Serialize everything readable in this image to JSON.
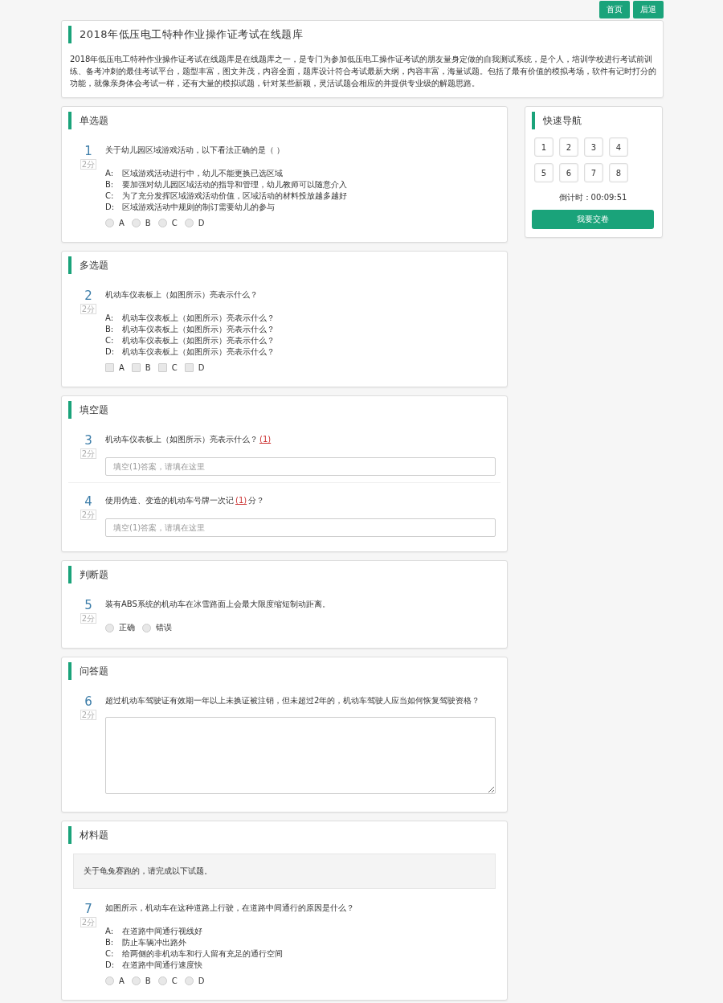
{
  "header_buttons": [
    {
      "label": "首页"
    },
    {
      "label": "后退"
    }
  ],
  "intro": {
    "title": "2018年低压电工特种作业操作证考试在线题库",
    "text": "2018年低压电工特种作业操作证考试在线题库是在线题库之一，是专门为参加低压电工操作证考试的朋友量身定做的自我测试系统，是个人，培训学校进行考试前训练、备考冲刺的最佳考试平台，题型丰富，图文并茂，内容全面，题库设计符合考试最新大纲，内容丰富，海量试题。包括了最有价值的模拟考场，软件有记时打分的功能，就像亲身体会考试一样，还有大量的模拟试题，针对某些新颖，灵活试题会相应的并提供专业级的解题思路。"
  },
  "sections": [
    {
      "title": "单选题",
      "kind": "choice",
      "questions": [
        {
          "number": "1",
          "score": "2分",
          "text": "关于幼儿园区域游戏活动，以下看法正确的是（        ）",
          "kind": "radio",
          "options": [
            {
              "letter": "A:",
              "text": "区域游戏活动进行中，幼儿不能更换已选区域"
            },
            {
              "letter": "B:",
              "text": "要加强对幼儿园区域活动的指导和管理，幼儿教师可以随意介入"
            },
            {
              "letter": "C:",
              "text": "为了充分发挥区域游戏活动价值，区域活动的材料投放越多越好"
            },
            {
              "letter": "D:",
              "text": "区域游戏活动中规则的制订需要幼儿的参与"
            }
          ],
          "choices": [
            {
              "label": "A",
              "selected": false
            },
            {
              "label": "B",
              "selected": false
            },
            {
              "label": "C",
              "selected": false
            },
            {
              "label": "D",
              "selected": false
            }
          ]
        }
      ]
    },
    {
      "title": "多选题",
      "kind": "choice",
      "questions": [
        {
          "number": "2",
          "score": "2分",
          "text": "机动车仪表板上（如图所示）亮表示什么？",
          "kind": "checkbox",
          "options": [
            {
              "letter": "A:",
              "text": "机动车仪表板上（如图所示）亮表示什么？"
            },
            {
              "letter": "B:",
              "text": "机动车仪表板上（如图所示）亮表示什么？"
            },
            {
              "letter": "C:",
              "text": "机动车仪表板上（如图所示）亮表示什么？"
            },
            {
              "letter": "D:",
              "text": "机动车仪表板上（如图所示）亮表示什么？"
            }
          ],
          "choices": [
            {
              "label": "A",
              "selected": false
            },
            {
              "label": "B",
              "selected": false
            },
            {
              "label": "C",
              "selected": false
            },
            {
              "label": "D",
              "selected": false
            }
          ]
        }
      ]
    },
    {
      "title": "填空题",
      "kind": "fill",
      "questions": [
        {
          "number": "3",
          "score": "2分",
          "text_before": "机动车仪表板上（如图所示）亮表示什么？",
          "blank": "(1)",
          "placeholder": "填空(1)答案，请填在这里"
        },
        {
          "number": "4",
          "score": "2分",
          "text_before": "使用伪造、变造的机动车号牌一次记",
          "blank": "(1)",
          "text_after": "分？",
          "placeholder": "填空(1)答案，请填在这里"
        }
      ]
    },
    {
      "title": "判断题",
      "kind": "choice",
      "questions": [
        {
          "number": "5",
          "score": "2分",
          "text": "装有ABS系统的机动车在冰雪路面上会最大限度缩短制动距离。",
          "kind": "radio",
          "choices": [
            {
              "label": "正确",
              "selected": false
            },
            {
              "label": "错误",
              "selected": false
            }
          ]
        }
      ]
    },
    {
      "title": "问答题",
      "kind": "essay",
      "questions": [
        {
          "number": "6",
          "score": "2分",
          "text": "超过机动车驾驶证有效期一年以上未换证被注销，但未超过2年的，机动车驾驶人应当如何恢复驾驶资格？"
        }
      ]
    },
    {
      "title": "材料题",
      "kind": "choice",
      "material": "关于龟兔赛跑的，请完成以下试题。",
      "questions": [
        {
          "number": "7",
          "score": "2分",
          "text": "如图所示，机动车在这种道路上行驶，在道路中间通行的原因是什么？",
          "kind": "radio",
          "options": [
            {
              "letter": "A:",
              "text": "在道路中间通行视线好"
            },
            {
              "letter": "B:",
              "text": "防止车辆冲出路外"
            },
            {
              "letter": "C:",
              "text": "给两侧的非机动车和行人留有充足的通行空间"
            },
            {
              "letter": "D:",
              "text": "在道路中间通行速度快"
            }
          ],
          "choices": [
            {
              "label": "A",
              "selected": false
            },
            {
              "label": "B",
              "selected": false
            },
            {
              "label": "C",
              "selected": false
            },
            {
              "label": "D",
              "selected": false
            }
          ]
        }
      ]
    }
  ],
  "nav": {
    "title": "快速导航",
    "items": [
      {
        "label": "1"
      },
      {
        "label": "2"
      },
      {
        "label": "3"
      },
      {
        "label": "4"
      },
      {
        "label": "5"
      },
      {
        "label": "6"
      },
      {
        "label": "7"
      },
      {
        "label": "8"
      }
    ],
    "timer": "倒计时：00:09:51",
    "submit": "我要交卷"
  }
}
